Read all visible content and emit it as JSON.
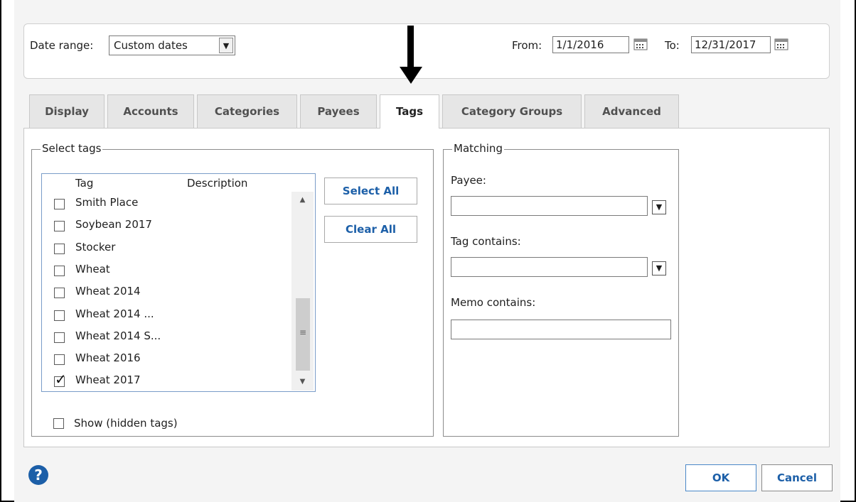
{
  "date_bar": {
    "date_range_label": "Date range:",
    "date_range_value": "Custom dates",
    "from_label": "From:",
    "from_value": "1/1/2016",
    "to_label": "To:",
    "to_value": "12/31/2017"
  },
  "tabs": [
    {
      "label": "Display"
    },
    {
      "label": "Accounts"
    },
    {
      "label": "Categories"
    },
    {
      "label": "Payees"
    },
    {
      "label": "Tags"
    },
    {
      "label": "Category Groups"
    },
    {
      "label": "Advanced"
    }
  ],
  "active_tab": "Tags",
  "select_tags": {
    "title": "Select tags",
    "col_tag": "Tag",
    "col_description": "Description",
    "items": [
      {
        "label": "Smith Place",
        "checked": false
      },
      {
        "label": "Soybean 2017",
        "checked": false
      },
      {
        "label": "Stocker",
        "checked": false
      },
      {
        "label": "Wheat",
        "checked": false
      },
      {
        "label": "Wheat 2014",
        "checked": false
      },
      {
        "label": "Wheat 2014 ...",
        "checked": false
      },
      {
        "label": "Wheat 2014 S...",
        "checked": false
      },
      {
        "label": "Wheat 2016",
        "checked": false
      },
      {
        "label": "Wheat 2017",
        "checked": true
      }
    ],
    "select_all": "Select All",
    "clear_all": "Clear All",
    "show_hidden": "Show (hidden tags)"
  },
  "matching": {
    "title": "Matching",
    "payee_label": "Payee:",
    "payee_value": "",
    "tag_contains_label": "Tag contains:",
    "tag_contains_value": "",
    "memo_contains_label": "Memo contains:",
    "memo_contains_value": ""
  },
  "footer": {
    "help_glyph": "?",
    "ok": "OK",
    "cancel": "Cancel"
  },
  "colors": {
    "accent": "#1c5fa8",
    "tab_inactive": "#e6e6e6",
    "background": "#f4f4f4"
  }
}
